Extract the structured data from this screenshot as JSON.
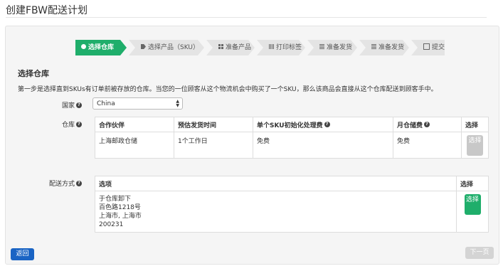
{
  "page": {
    "title": "创建FBW配送计划"
  },
  "steps": [
    {
      "label": "选择仓库",
      "icon": "globe-icon",
      "active": true
    },
    {
      "label": "选择产品（SKU）",
      "icon": "tag-icon"
    },
    {
      "label": "准备产品",
      "icon": "grid-icon"
    },
    {
      "label": "打印标签",
      "icon": "barcode-icon"
    },
    {
      "label": "准备发货",
      "icon": "list-icon"
    },
    {
      "label": "准备发货",
      "icon": "list-icon"
    },
    {
      "label": "提交",
      "icon": "check-square-icon"
    }
  ],
  "section": {
    "title": "选择仓库",
    "intro": "第一步是选择直到SKUs有订单前被存放的仓库。当您的一位顾客从这个物流机会中购买了一个SKU，那么该商品会直接从这个仓库配送到顾客手中。"
  },
  "form": {
    "country_label": "国家",
    "country_value": "China",
    "warehouse_label": "仓库",
    "shipping_label": "配送方式"
  },
  "warehouse_table": {
    "headers": [
      "合作伙伴",
      "预估发货时间",
      "单个SKU初始化处理费",
      "月仓储费",
      "选择"
    ],
    "row": {
      "partner": "上海邮政仓储",
      "time": "1个工作日",
      "fee": "免费",
      "storage": "免费",
      "select": "选择"
    }
  },
  "shipping_table": {
    "headers": [
      "选项",
      "选择"
    ],
    "address": [
      "于仓库卸下",
      "百色路1218号",
      "上海市, 上海市",
      "200231"
    ],
    "select": "选择"
  },
  "buttons": {
    "back": "返回",
    "next": "下一页"
  },
  "colors": {
    "accent_green": "#1fae6b",
    "primary_blue": "#1a64c4",
    "disabled_gray": "#c8c8c8"
  }
}
